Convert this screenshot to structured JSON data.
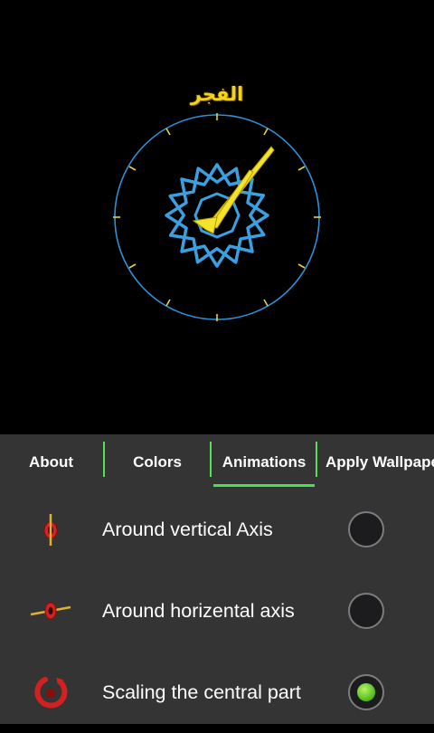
{
  "clock": {
    "label": "الفجر"
  },
  "tabs": [
    {
      "label": "About",
      "selected": false
    },
    {
      "label": "Colors",
      "selected": false
    },
    {
      "label": "Animations",
      "selected": true
    },
    {
      "label": "Apply Wallpaper",
      "selected": false
    }
  ],
  "options": [
    {
      "icon": "vertical-axis-rotation-icon",
      "label": "Around vertical Axis",
      "selected": false
    },
    {
      "icon": "horizontal-axis-rotation-icon",
      "label": "Around horizental axis",
      "selected": false
    },
    {
      "icon": "scaling-icon",
      "label": "Scaling the central part",
      "selected": true
    }
  ],
  "colors": {
    "accent": "#49e049",
    "clock_ring": "#2f8fd6",
    "star": "#3aa0e0",
    "hand": "#f5e32a",
    "panel_bg": "#343434"
  }
}
